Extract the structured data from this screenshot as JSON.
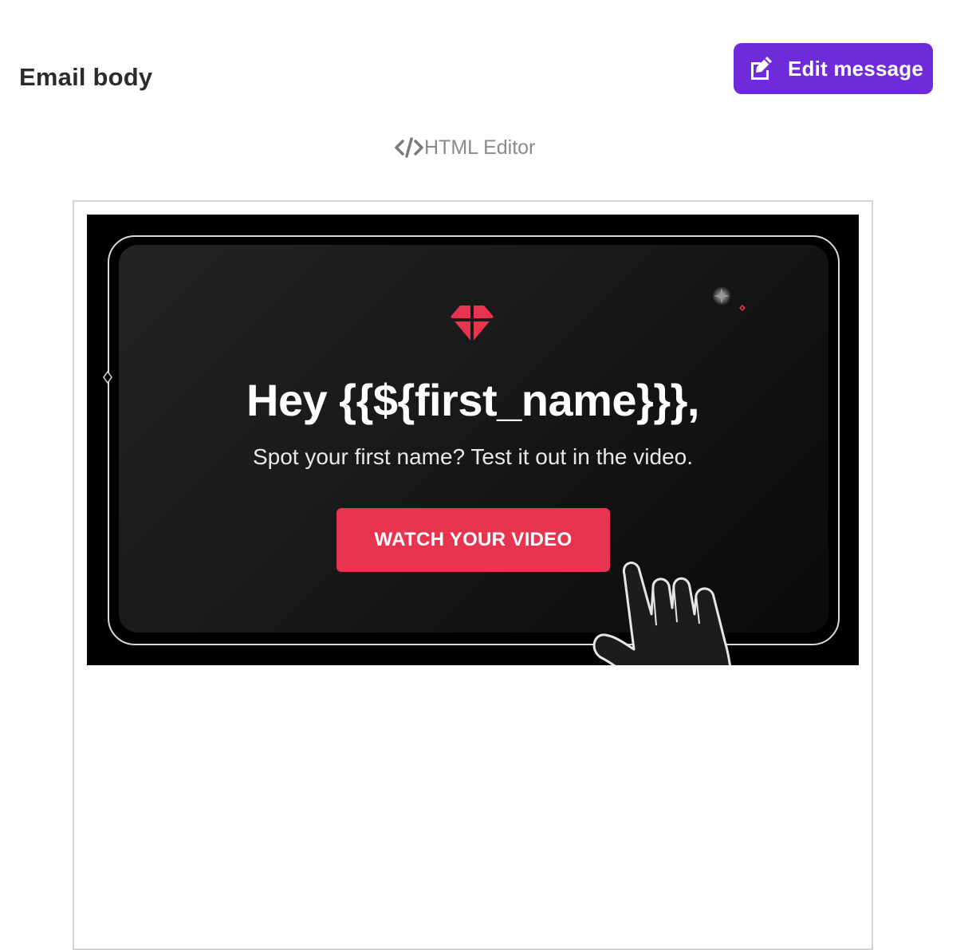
{
  "header": {
    "title": "Email body",
    "edit_button_label": "Edit message",
    "edit_icon": "edit-icon"
  },
  "editor_link": {
    "label": "HTML Editor",
    "icon": "code-icon"
  },
  "preview": {
    "headline": "Hey {{${first_name}}},",
    "subtext": "Spot your first name? Test it out in the video.",
    "cta_label": "WATCH YOUR VIDEO",
    "logo_icon": "heart-gem-logo",
    "pointer_icon": "hand-pointer-icon"
  },
  "colors": {
    "accent": "#6f2bd9",
    "cta": "#e8354f",
    "banner_bg": "#000000"
  }
}
